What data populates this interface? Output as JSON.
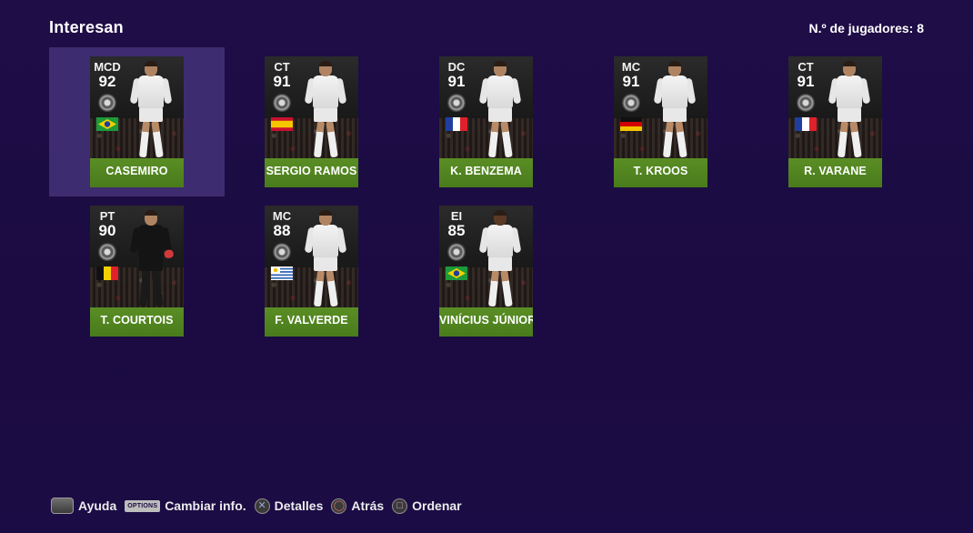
{
  "header": {
    "title": "Interesan",
    "count_label": "N.º de jugadores: 8"
  },
  "players": [
    {
      "position": "MCD",
      "rating": "92",
      "name": "CASEMIRO",
      "nationality": "Brazil",
      "selected": true
    },
    {
      "position": "CT",
      "rating": "91",
      "name": "SERGIO RAMOS",
      "nationality": "Spain",
      "selected": false
    },
    {
      "position": "DC",
      "rating": "91",
      "name": "K. BENZEMA",
      "nationality": "France",
      "selected": false
    },
    {
      "position": "MC",
      "rating": "91",
      "name": "T. KROOS",
      "nationality": "Germany",
      "selected": false
    },
    {
      "position": "CT",
      "rating": "91",
      "name": "R. VARANE",
      "nationality": "France",
      "selected": false
    },
    {
      "position": "PT",
      "rating": "90",
      "name": "T. COURTOIS",
      "nationality": "Belgium",
      "selected": false
    },
    {
      "position": "MC",
      "rating": "88",
      "name": "F. VALVERDE",
      "nationality": "Uruguay",
      "selected": false
    },
    {
      "position": "EI",
      "rating": "85",
      "name": "VINÍCIUS JÚNIOR",
      "nationality": "Brazil",
      "selected": false
    }
  ],
  "footer": {
    "help": {
      "icon": "touchpad-icon",
      "label": "Ayuda"
    },
    "options": {
      "icon": "options-button-icon",
      "button_text": "OPTIONS",
      "label": "Cambiar info."
    },
    "details": {
      "icon": "cross-button-icon",
      "label": "Detalles"
    },
    "back": {
      "icon": "circle-button-icon",
      "label": "Atrás"
    },
    "sort": {
      "icon": "square-button-icon",
      "label": "Ordenar"
    }
  },
  "colors": {
    "background": "#1c0c44",
    "selection": "#3e2c70",
    "card_stripe": "#5a8e24"
  }
}
